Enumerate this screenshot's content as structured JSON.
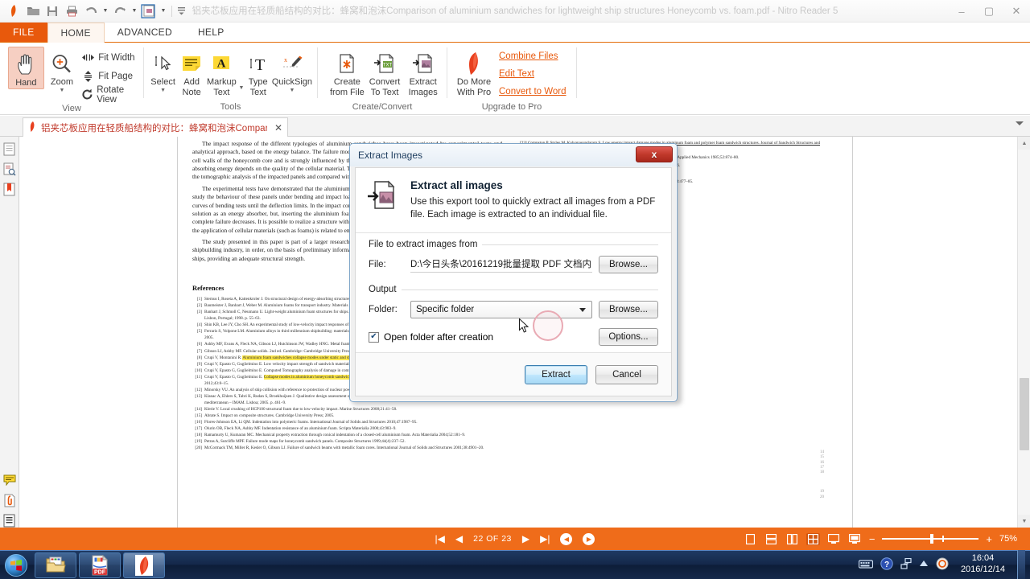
{
  "window": {
    "title": "铝夹芯板应用在轻质船结构的对比：蜂窝和泡沫Comparison of aluminium sandwiches for lightweight ship structures Honeycomb vs. foam.pdf - Nitro Reader 5",
    "minimize": "–",
    "maximize": "▢",
    "close": "✕"
  },
  "quick_access": {
    "items": [
      {
        "name": "nitro-logo-icon",
        "label": ""
      },
      {
        "name": "open-icon",
        "label": ""
      },
      {
        "name": "save-icon",
        "label": ""
      },
      {
        "name": "print-icon",
        "label": ""
      },
      {
        "name": "undo-icon",
        "label": ""
      },
      {
        "name": "redo-icon",
        "label": ""
      },
      {
        "name": "extract-images-icon",
        "label": ""
      },
      {
        "name": "customize-qat-icon",
        "label": ""
      }
    ]
  },
  "ribbon": {
    "tabs": [
      {
        "label": "FILE",
        "active": false,
        "kind": "file"
      },
      {
        "label": "HOME",
        "active": true,
        "kind": "normal"
      },
      {
        "label": "ADVANCED",
        "active": false,
        "kind": "normal"
      },
      {
        "label": "HELP",
        "active": false,
        "kind": "normal"
      }
    ],
    "groups": [
      {
        "name": "view",
        "label": "View",
        "big_buttons": [
          {
            "label": "Hand",
            "icon": "hand-icon",
            "selected": true,
            "has_caret": false
          },
          {
            "label": "Zoom",
            "icon": "magnifier-plus-icon",
            "selected": false,
            "has_caret": true
          }
        ],
        "small_buttons": [
          {
            "label": "Fit Width",
            "icon": "fit-width-icon"
          },
          {
            "label": "Fit Page",
            "icon": "fit-page-icon"
          },
          {
            "label": "Rotate View",
            "icon": "rotate-view-icon"
          }
        ]
      },
      {
        "name": "tools",
        "label": "Tools",
        "big_buttons": [
          {
            "label": "Select",
            "icon": "select-cursor-icon",
            "selected": false,
            "has_caret": true
          },
          {
            "label": "Add Note",
            "icon": "sticky-note-icon",
            "selected": false,
            "has_caret": false
          },
          {
            "label": "Markup Text",
            "icon": "markup-text-icon",
            "selected": false,
            "has_caret": true
          },
          {
            "label": "Type Text",
            "icon": "type-text-icon",
            "selected": false,
            "has_caret": false
          },
          {
            "label": "QuickSign",
            "icon": "quicksign-pen-icon",
            "selected": false,
            "has_caret": true
          }
        ]
      },
      {
        "name": "create-convert",
        "label": "Create/Convert",
        "big_buttons": [
          {
            "label": "Create from File",
            "icon": "create-from-file-icon",
            "selected": false,
            "has_caret": false
          },
          {
            "label": "Convert To Text",
            "icon": "convert-to-text-icon",
            "selected": false,
            "has_caret": false
          },
          {
            "label": "Extract Images",
            "icon": "extract-images-icon",
            "selected": false,
            "has_caret": false
          }
        ]
      },
      {
        "name": "upgrade-to-pro",
        "label": "Upgrade to Pro",
        "big_buttons": [
          {
            "label": "Do More With Pro",
            "icon": "nitro-pro-icon",
            "selected": false,
            "has_caret": false
          }
        ],
        "links": [
          "Combine Files",
          "Edit Text",
          "Convert to Word"
        ]
      }
    ]
  },
  "document_tab": {
    "title": "铝夹芯板应用在轻质船结构的对比：蜂窝和泡沫Comparison o...",
    "close": "✕"
  },
  "nav_rail": {
    "items": [
      {
        "name": "pages-panel-icon"
      },
      {
        "name": "search-document-icon"
      },
      {
        "name": "bookmarks-icon"
      },
      {
        "name": "comments-icon"
      },
      {
        "name": "attachments-icon"
      },
      {
        "name": "layers-icon"
      }
    ]
  },
  "document": {
    "left_column_paragraphs": [
      "The impact response of the different typologies of aluminium sandwiches have been investigated by experimental tests and analytical approach, based on the energy balance. The failure mode of honeycomb panels occurs for progressive crumpling of the cell walls of the honeycomb core and is strongly influenced by the cell size, whereas the foam core sandwich panels capacity of absorbing energy depends on the quality of the cellular material. The constants, that described the dynamic behaviour, obtained by the tomographic analysis of the impacted panels and compared with the ones done in literature.",
      "The experimental tests have demonstrated that the aluminium sandwiches show good properties of energy dissipation. In our study the behaviour of these panels under bending and impact loading, considering the different failure modes and the deflection curves of bending tests until the deflection limits. In the impact conditions a simple foam structure doesn't always represent the best solution as an energy absorber, but, inserting the aluminium foam in a sandwich structure, the amount required to produce the complete failure decreases. It is possible to realize a structure with excellent energy absorption capabilities. The growing interest in the application of cellular materials (such as foams) is related to energy absorption devices.",
      "The study presented in this paper is part of a larger research program on structures, made of aluminium sandwiches, in the shipbuilding industry, in order, on the basis of preliminary information obtained from the present tests, the weight reduction of the ships, providing an adequate structural strength."
    ],
    "references_heading": "References",
    "references": [
      {
        "n": "[1]",
        "text": "Sternus I, Roseta A, Kattenkroler J. On structural design of energy-absorbing structures. Marine Structures 2011;24:43–59."
      },
      {
        "n": "[2]",
        "text": "Baumeister J, Banhart J, Weber M. Aluminium foams for transport industry. Materials and Design 1997;18:217–20."
      },
      {
        "n": "[3]",
        "text": "Banhart J, Schmoll C, Neumann U. Light-weight aluminium foam structures for ships. In: Proceedings of the conference on materials in oceanic environment (Euromat '98), Lisbon, Portugal; 1998. p. 55–63."
      },
      {
        "n": "[4]",
        "text": "Shin KB, Lee JY, Cho SH. An experimental study of low-velocity impact responses of sandwich panels for Korean low floor bus. Composite Structures 2008;84( 3):228–40."
      },
      {
        "n": "[5]",
        "text": "Ferraris S, Volpone LM. Aluminium alloys in third millennium shipbuilding: materials, technologies, perspectives. In: the fifth international forum on aluminium ships; October, 2005."
      },
      {
        "n": "[6]",
        "text": "Ashby MF, Evans A, Fleck NA, Gibson LJ, Hutchinson JW, Wadley HNG. Metal foams: a design guide. Boston: Butterworth Heinemann; 2000."
      },
      {
        "n": "[7]",
        "text": "Gibson LJ, Ashby MF. Cellular solids. 2nd ed. Cambridge: Cambridge University Press; 1997."
      },
      {
        "n": "[8]",
        "text": "Crupi V, Montanini R.",
        "hl": "Aluminium foam sandwiches collapse modes under static and dynamic three-point bending.",
        "tail": "International Journal of Impact Engineering 2007;34:509–21."
      },
      {
        "n": "[9]",
        "text": "Crupi V, Epasto G, Guglielmino E. Low velocity impact strength of sandwich materials. Journal of Sandwich Structures and Materials 2011;13(4):409–26."
      },
      {
        "n": "[10]",
        "text": "Crupi V, Epasto G, Guglielmino E. Computed Tomography analysis of damage in composites subjected to impact loading. Fracture and Structural Integrity 2011;17:32–41."
      },
      {
        "n": "[11]",
        "text": "Crupi V, Epasto G, Guglielmino E.",
        "hl": "Collapse modes in aluminium honeycomb sandwich panels under bending and impact loading.",
        "tail": "International Journal of Impact Engineering 2012;43:8–15."
      },
      {
        "n": "[12]",
        "text": "Minorsky VU. An analysis of ship collision with reference to protection of nuclear powered plant. Journal of Ship Research 1959;3(2):1–4."
      },
      {
        "n": "[13]",
        "text": "Klanac A, Ehlers S, Tabri K, Rudan S, Broekhuijsen J. Qualitative design assessment of crashworthy structures. In: Proceedings of international maritime association of mediterranean – IMAM. Lisboa; 2005. p. 461–9."
      },
      {
        "n": "[14]",
        "text": "Klerie V. Local crushing of HCP100 structural foam due to low-velocity impact. Marine Structures 2008;21:41–58."
      },
      {
        "n": "[15]",
        "text": "Abrate S. Impact on composite structures. Cambridge University Press; 2005."
      },
      {
        "n": "[16]",
        "text": "Flores-Johnson EA, Li QM. Indentation into polymeric foams. International Journal of Solids and Structures 2010;47:1987–95."
      },
      {
        "n": "[17]",
        "text": "Olurin OB, Fleck NA, Ashby MF. Indentation resistance of an aluminium foam. Scripta Materialia 2000;43:983–9."
      },
      {
        "n": "[18]",
        "text": "Ramamurty U, Kumaran MC. Mechanical property extraction through conical indentation of a closed-cell aluminium foam. Acta Materialia 2004;52:181–9."
      },
      {
        "n": "[19]",
        "text": "Petras A, Sutcliffe MPF. Failure mode maps for honeycomb sandwich panels. Composite Structures 1999;44(4):237–52."
      },
      {
        "n": "[20]",
        "text": "McCormack TM, Miller R, Kesler O, Gibson LJ. Failure of sandwich beams with metallic foam cores. International Journal of Solids and Structures 2001;38:4901–20."
      }
    ],
    "right_column_partial": [
      "[23] Compston P, Styles M, Kalyanasundaram S. Low energy impact damage modes in aluminum foam and polymer foam sandwich structures. Journal of Sandwich Structures and Materials 2006;8:365–79.",
      "impact force and duration during low-velocity impact on circular composite plates. Journal of Applied Mechanics 1985;52:874–80.",
      "Low – velocity impact response and damage in sandwich composites. Composites 1996;27:1–6.",
      "Indentation failure of aluminium honeycomb sandwich panels. Composite Structures",
      "Low velocity impact response of foam-based sandwich structures. Composites: Part B 2002;33:477–85."
    ],
    "page_numbers": [
      "14",
      "15",
      "16",
      "17",
      "18",
      "19",
      "20"
    ]
  },
  "status_bar": {
    "first_page": "|◀",
    "prev_page": "◀",
    "page_indicator": "22 OF 23",
    "next_page": "▶",
    "last_page": "▶|",
    "prev_view": "◀",
    "next_view": "▶",
    "view_modes": [
      {
        "name": "single-page-mode",
        "active": false
      },
      {
        "name": "continuous-mode",
        "active": false
      },
      {
        "name": "two-page-mode",
        "active": false
      },
      {
        "name": "two-page-continuous-mode",
        "active": true
      },
      {
        "name": "fit-to-screen-mode",
        "active": false
      },
      {
        "name": "full-screen-mode",
        "active": false
      }
    ],
    "zoom_out": "−",
    "zoom_in": "+",
    "zoom_value": "75%"
  },
  "dialog": {
    "titlebar": "Extract Images",
    "close_label": "x",
    "hero_title": "Extract all images",
    "hero_text": "Use this export tool to quickly extract all images from a PDF file. Each image is extracted to an individual file.",
    "source_section_label": "File to extract images from",
    "file_label": "File:",
    "file_path": "D:\\今日头条\\20161219批量提取 PDF 文档内",
    "file_browse": "Browse...",
    "output_section_label": "Output",
    "folder_label": "Folder:",
    "folder_value": "Specific folder",
    "folder_browse": "Browse...",
    "open_folder_label": "Open folder after creation",
    "open_folder_checked": true,
    "options_button": "Options...",
    "extract_button": "Extract",
    "cancel_button": "Cancel"
  },
  "taskbar": {
    "start": "start-orb-icon",
    "items": [
      {
        "name": "taskbar-explorer",
        "active": false
      },
      {
        "name": "taskbar-pdf-reader",
        "active": false
      },
      {
        "name": "taskbar-nitro-reader",
        "active": true
      }
    ],
    "tray": [
      {
        "name": "keyboard-ime-icon"
      },
      {
        "name": "help-icon"
      },
      {
        "name": "network-icon"
      },
      {
        "name": "show-hidden-icons-icon"
      },
      {
        "name": "antivirus-icon"
      }
    ],
    "clock_time": "16:04",
    "clock_date": "2016/12/14"
  },
  "colors": {
    "accent_orange": "#ef6c1a",
    "file_tab_orange": "#e8590c",
    "highlight_yellow": "#ffe94d",
    "tab_title_red": "#c0392b"
  }
}
